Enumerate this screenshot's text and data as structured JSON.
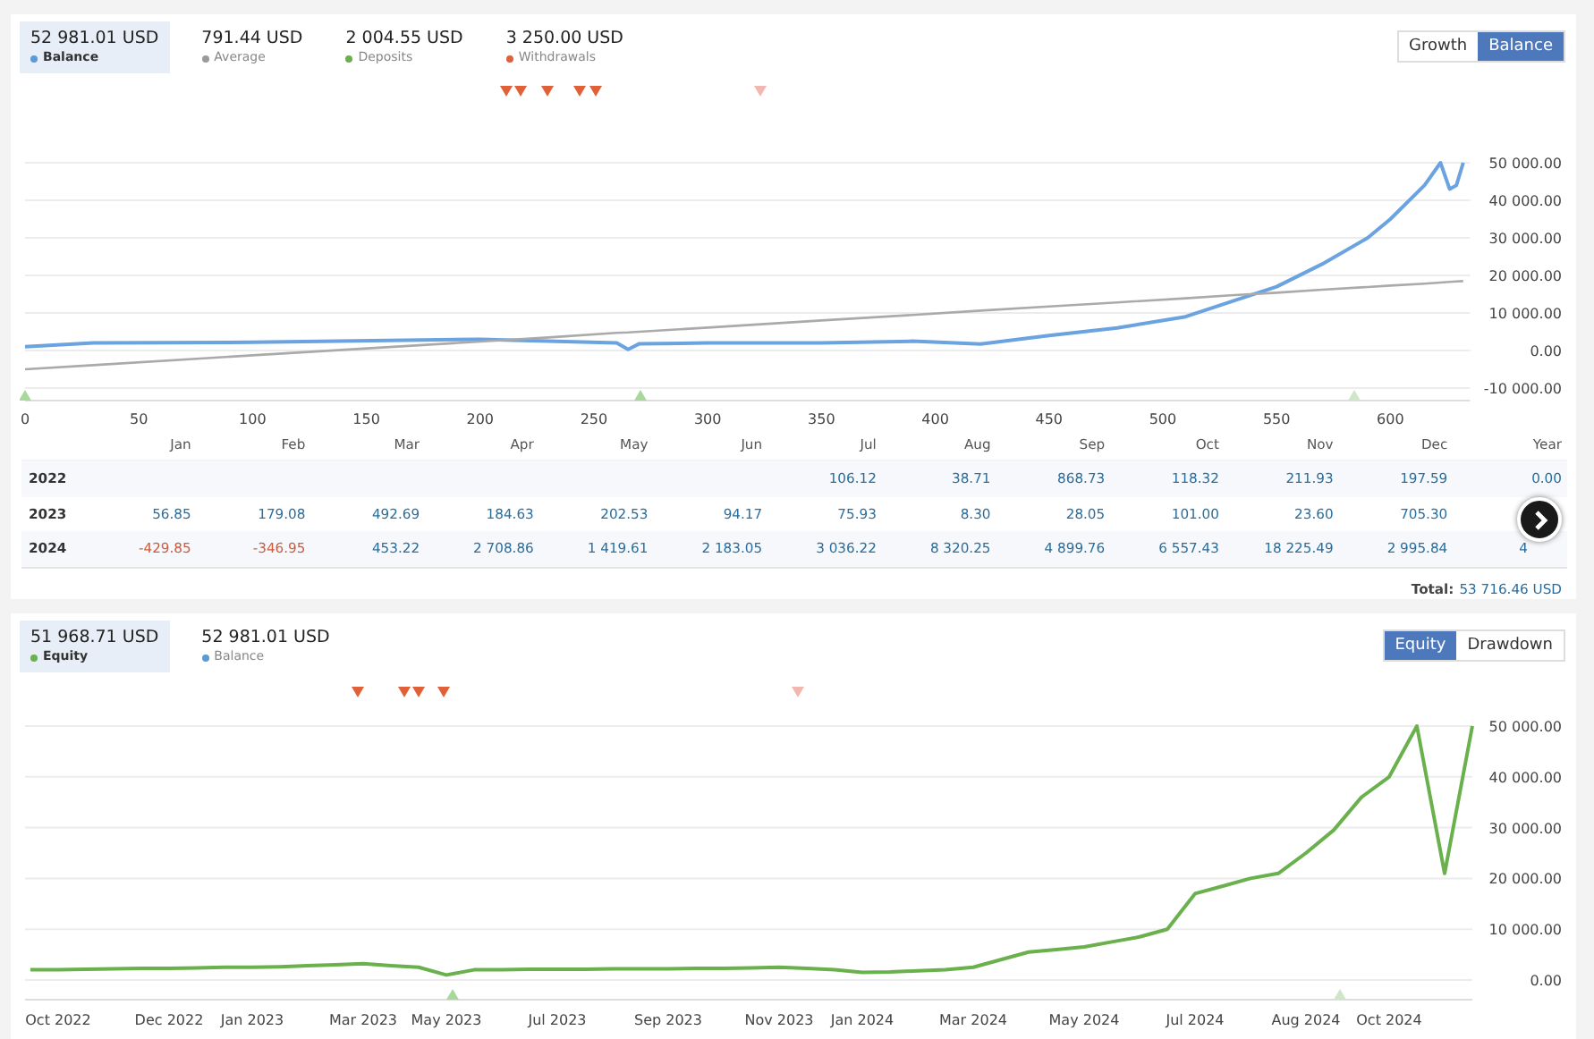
{
  "balance_panel": {
    "stats": [
      {
        "value": "52 981.01 USD",
        "label": "Balance",
        "color": "#5b9bd5",
        "selected": true
      },
      {
        "value": "791.44 USD",
        "label": "Average",
        "color": "#9a9a9a",
        "selected": false
      },
      {
        "value": "2 004.55 USD",
        "label": "Deposits",
        "color": "#6ab04c",
        "selected": false
      },
      {
        "value": "3 250.00 USD",
        "label": "Withdrawals",
        "color": "#e0603a",
        "selected": false
      }
    ],
    "toggles": [
      {
        "label": "Growth",
        "selected": false
      },
      {
        "label": "Balance",
        "selected": true
      }
    ],
    "chart_data": {
      "type": "line",
      "grid": true,
      "xlim": [
        0,
        635
      ],
      "ylim": [
        -10000,
        50000
      ],
      "xticks": [
        0,
        50,
        100,
        150,
        200,
        250,
        300,
        350,
        400,
        450,
        500,
        550,
        600
      ],
      "yticks": [
        {
          "value": -10000,
          "label": "-10 000.00"
        },
        {
          "value": 0,
          "label": "0.00"
        },
        {
          "value": 10000,
          "label": "10 000.00"
        },
        {
          "value": 20000,
          "label": "20 000.00"
        },
        {
          "value": 30000,
          "label": "30 000.00"
        },
        {
          "value": 40000,
          "label": "40 000.00"
        },
        {
          "value": 50000,
          "label": "50 000.00"
        }
      ],
      "x": [
        0,
        30,
        100,
        200,
        230,
        260,
        265,
        270,
        300,
        350,
        390,
        420,
        450,
        480,
        510,
        530,
        550,
        570,
        590,
        600,
        615,
        622,
        626,
        629,
        632
      ],
      "series": [
        {
          "color": "#6aa3e0",
          "values": [
            1000,
            2000,
            2200,
            3000,
            2500,
            2000,
            300,
            1800,
            2000,
            2000,
            2500,
            1700,
            4000,
            6000,
            9000,
            13000,
            17000,
            23000,
            30000,
            35000,
            44000,
            50000,
            43000,
            44000,
            50000
          ]
        },
        {
          "color": "#aaaaaa",
          "values": [
            -5000,
            -3900,
            -1300,
            2400,
            3500,
            4700,
            4800,
            5000,
            6100,
            8000,
            9500,
            10600,
            11700,
            12800,
            13900,
            14700,
            15400,
            16200,
            16900,
            17300,
            17800,
            18100,
            18300,
            18400,
            18500
          ]
        }
      ]
    },
    "event_markers": [
      {
        "kind": "withdrawal",
        "color": "#e0603a"
      },
      {
        "kind": "withdrawal",
        "color": "#e0603a"
      },
      {
        "kind": "withdrawal",
        "color": "#e0603a"
      },
      {
        "kind": "withdrawal",
        "color": "#e0603a"
      },
      {
        "kind": "withdrawal",
        "color": "#e0603a"
      },
      {
        "kind": "withdrawal",
        "color": "#f2b8b0"
      },
      {
        "kind": "deposit",
        "color": "#a8d89a"
      },
      {
        "kind": "deposit",
        "color": "#a8d89a"
      },
      {
        "kind": "deposit",
        "color": "#cfe6c8"
      }
    ],
    "table": {
      "columns": [
        "Jan",
        "Feb",
        "Mar",
        "Apr",
        "May",
        "Jun",
        "Jul",
        "Aug",
        "Sep",
        "Oct",
        "Nov",
        "Dec",
        "Year"
      ],
      "rows": [
        {
          "year": "2022",
          "cells": [
            {
              "text": ""
            },
            {
              "text": ""
            },
            {
              "text": ""
            },
            {
              "text": ""
            },
            {
              "text": ""
            },
            {
              "text": ""
            },
            {
              "text": "106.12",
              "negative": false
            },
            {
              "text": "38.71",
              "negative": false
            },
            {
              "text": "868.73",
              "negative": false
            },
            {
              "text": "118.32",
              "negative": false
            },
            {
              "text": "211.93",
              "negative": false
            },
            {
              "text": "197.59",
              "negative": false
            },
            {
              "text": "0.00",
              "negative": false
            }
          ]
        },
        {
          "year": "2023",
          "cells": [
            {
              "text": "56.85",
              "negative": false
            },
            {
              "text": "179.08",
              "negative": false
            },
            {
              "text": "492.69",
              "negative": false
            },
            {
              "text": "184.63",
              "negative": false
            },
            {
              "text": "202.53",
              "negative": false
            },
            {
              "text": "94.17",
              "negative": false
            },
            {
              "text": "75.93",
              "negative": false
            },
            {
              "text": "8.30",
              "negative": false
            },
            {
              "text": "28.05",
              "negative": false
            },
            {
              "text": "101.00",
              "negative": false
            },
            {
              "text": "23.60",
              "negative": false
            },
            {
              "text": "705.30",
              "negative": false
            },
            {
              "text": ""
            }
          ]
        },
        {
          "year": "2024",
          "cells": [
            {
              "text": "-429.85",
              "negative": true
            },
            {
              "text": "-346.95",
              "negative": true
            },
            {
              "text": "453.22",
              "negative": false
            },
            {
              "text": "2 708.86",
              "negative": false
            },
            {
              "text": "1 419.61",
              "negative": false
            },
            {
              "text": "2 183.05",
              "negative": false
            },
            {
              "text": "3 036.22",
              "negative": false
            },
            {
              "text": "8 320.25",
              "negative": false
            },
            {
              "text": "4 899.76",
              "negative": false
            },
            {
              "text": "6 557.43",
              "negative": false
            },
            {
              "text": "18 225.49",
              "negative": false
            },
            {
              "text": "2 995.84",
              "negative": false
            },
            {
              "text": "4",
              "negative": false
            }
          ]
        }
      ],
      "total_label": "Total:",
      "total_value": "53 716.46 USD"
    }
  },
  "equity_panel": {
    "stats": [
      {
        "value": "51 968.71 USD",
        "label": "Equity",
        "color": "#6ab04c",
        "selected": true
      },
      {
        "value": "52 981.01 USD",
        "label": "Balance",
        "color": "#5b9bd5",
        "selected": false
      }
    ],
    "toggles": [
      {
        "label": "Equity",
        "selected": true
      },
      {
        "label": "Drawdown",
        "selected": false
      }
    ],
    "chart_data": {
      "type": "line",
      "grid": true,
      "ylim": [
        0,
        50000
      ],
      "categories": [
        null,
        "Oct 2022",
        null,
        null,
        null,
        "Dec 2022",
        null,
        null,
        "Jan 2023",
        null,
        null,
        null,
        "Mar 2023",
        null,
        null,
        "May 2023",
        null,
        null,
        null,
        "Jul 2023",
        null,
        null,
        null,
        "Sep 2023",
        null,
        null,
        null,
        "Nov 2023",
        null,
        null,
        "Jan 2024",
        null,
        null,
        null,
        "Mar 2024",
        null,
        null,
        null,
        "May 2024",
        null,
        null,
        null,
        "Jul 2024",
        null,
        null,
        null,
        "Aug 2024",
        null,
        null,
        "Oct 2024",
        null,
        null,
        null
      ],
      "yticks": [
        {
          "value": 0,
          "label": "0.00"
        },
        {
          "value": 10000,
          "label": "10 000.00"
        },
        {
          "value": 20000,
          "label": "20 000.00"
        },
        {
          "value": 30000,
          "label": "30 000.00"
        },
        {
          "value": 40000,
          "label": "40 000.00"
        },
        {
          "value": 50000,
          "label": "50 000.00"
        }
      ],
      "series": [
        {
          "color": "#6ab04c",
          "values": [
            2000,
            2000,
            2100,
            2200,
            2300,
            2300,
            2400,
            2500,
            2500,
            2600,
            2800,
            3000,
            3200,
            2800,
            2500,
            1000,
            2000,
            2000,
            2100,
            2100,
            2100,
            2200,
            2200,
            2200,
            2300,
            2300,
            2400,
            2500,
            2300,
            2000,
            1500,
            1600,
            1800,
            2000,
            2500,
            4000,
            5500,
            6000,
            6500,
            7500,
            8500,
            10000,
            17000,
            18500,
            20000,
            21000,
            25000,
            29500,
            36000,
            40000,
            50000,
            21000,
            50000
          ]
        }
      ]
    },
    "event_markers": [
      {
        "kind": "withdrawal",
        "color": "#e0603a"
      },
      {
        "kind": "withdrawal",
        "color": "#e0603a"
      },
      {
        "kind": "withdrawal",
        "color": "#e0603a"
      },
      {
        "kind": "withdrawal",
        "color": "#e0603a"
      },
      {
        "kind": "withdrawal",
        "color": "#f2b8b0"
      },
      {
        "kind": "deposit",
        "color": "#a8d89a"
      },
      {
        "kind": "deposit",
        "color": "#cfe6c8"
      }
    ]
  }
}
